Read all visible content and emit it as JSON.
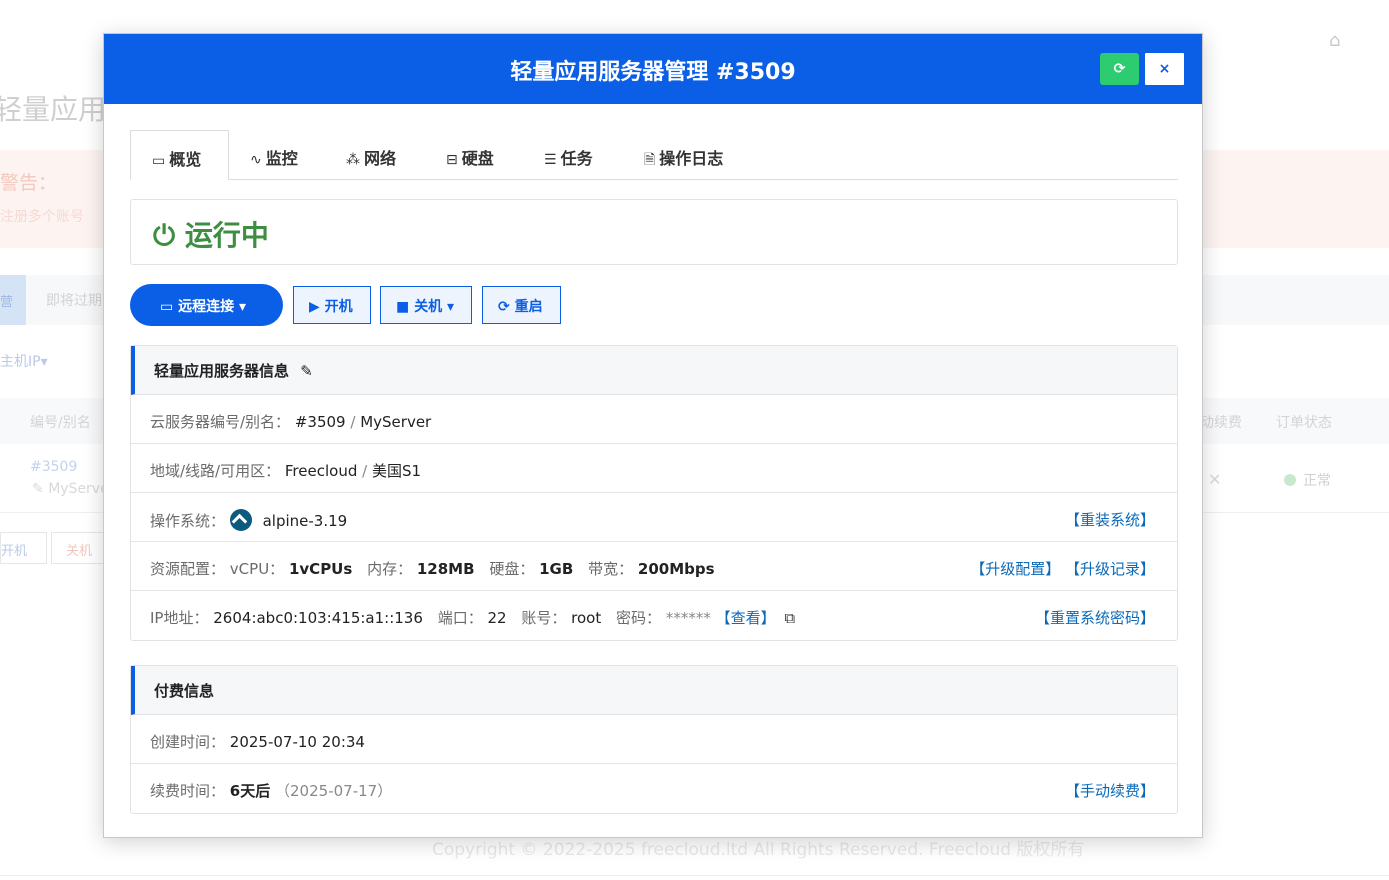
{
  "background": {
    "page_title": "轻量应用",
    "warning_title": "警告：",
    "warning_text": "注册多个账号",
    "tabs": [
      "营",
      "即将过期"
    ],
    "filter": "主机IP▾",
    "columns": [
      "编号/别名",
      "动续费",
      "订单状态"
    ],
    "row": {
      "id": "#3509",
      "alias": "MyServer",
      "status": "正常"
    },
    "buttons": [
      "开机",
      "关机"
    ],
    "copyright": "Copyright © 2022-2025 freecloud.ltd All Rights Reserved. Freecloud 版权所有"
  },
  "modal": {
    "title": "轻量应用服务器管理 #3509",
    "refresh_icon": "refresh-icon",
    "close_label": "×"
  },
  "tabs": [
    {
      "label": "概览",
      "icon": "monitor-icon"
    },
    {
      "label": "监控",
      "icon": "pulse-icon"
    },
    {
      "label": "网络",
      "icon": "sitemap-icon"
    },
    {
      "label": "硬盘",
      "icon": "hdd-icon"
    },
    {
      "label": "任务",
      "icon": "tasks-icon"
    },
    {
      "label": "操作日志",
      "icon": "file-icon"
    }
  ],
  "status": {
    "label": "运行中",
    "icon": "power-icon",
    "color": "#3e8e41"
  },
  "actions": {
    "remote": "远程连接",
    "power_on": "开机",
    "power_off": "关机",
    "reboot": "重启"
  },
  "server_info": {
    "heading": "轻量应用服务器信息",
    "id_label": "云服务器编号/别名：",
    "id_value": "#3509",
    "alias": "MyServer",
    "region_label": "地域/线路/可用区：",
    "region": "Freecloud",
    "zone": "美国S1",
    "os_label": "操作系统：",
    "os": "alpine-3.19",
    "reinstall": "【重装系统】",
    "res_label": "资源配置：",
    "vcpu_label": "vCPU：",
    "vcpu": "1vCPUs",
    "mem_label": "内存：",
    "mem": "128MB",
    "disk_label": "硬盘：",
    "disk": "1GB",
    "bw_label": "带宽：",
    "bw": "200Mbps",
    "upgrade": "【升级配置】",
    "upgrade_log": "【升级记录】",
    "ip_label": "IP地址：",
    "ip": "2604:abc0:103:415:a1::136",
    "port_label": "端口：",
    "port": "22",
    "account_label": "账号：",
    "account": "root",
    "pwd_label": "密码：",
    "pwd": "******",
    "view": "【查看】",
    "reset_pwd": "【重置系统密码】"
  },
  "billing": {
    "heading": "付费信息",
    "created_label": "创建时间：",
    "created": "2025-07-10 20:34",
    "renew_label": "续费时间：",
    "renew_in": "6天后",
    "renew_date": "（2025-07-17）",
    "manual_renew": "【手动续费】"
  },
  "colors": {
    "primary": "#0b5ee6",
    "success": "#2ecc71",
    "running": "#3e8e41",
    "link": "#0b6ab8"
  }
}
